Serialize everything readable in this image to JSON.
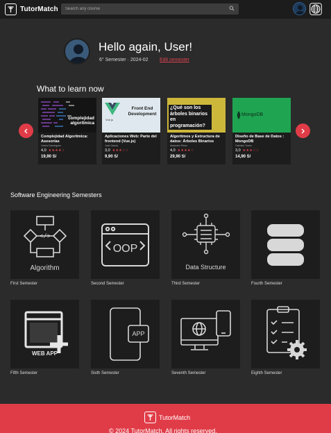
{
  "header": {
    "brand": "TutorMatch",
    "search_placeholder": "Search any course"
  },
  "hero": {
    "greeting": "Hello again, User!",
    "semester_info": "6° Semester · 2024-02",
    "edit_label": "Edit semester"
  },
  "learn_title": "What to learn now",
  "courses": [
    {
      "title": "Complejidad Algorítmica: Asesorías",
      "author": "Carlos Domínguez",
      "rating": "4,0",
      "price": "19,90 S/",
      "thumb_text": "complejidad algorítmica"
    },
    {
      "title": "Aplicaciones Web: Parte del frontend (Vue.js)",
      "author": "José García",
      "rating": "3,0",
      "price": "9,90 S/",
      "thumb_text": "Front End Development",
      "thumb_tag": "Vue.js"
    },
    {
      "title": "Algoritmos y Estructura de datos: Árboles Binarios",
      "author": "Alejandro Pérez",
      "rating": "4,0",
      "price": "29,90 S/",
      "thumb_text": "¿Qué son los árboles binarios en programación?"
    },
    {
      "title": "Diseño de Base de Datos : MongoDB",
      "author": "Gabriela Torres",
      "rating": "3,0",
      "price": "14,90 S/",
      "thumb_text": "MongoDB"
    }
  ],
  "semesters_title": "Software Engineering Semesters",
  "semesters": [
    {
      "label": "First Semester",
      "icon_text": "Algorithm"
    },
    {
      "label": "Second Semester",
      "icon_text": "OOP"
    },
    {
      "label": "Third Semester",
      "icon_text": "Data Structure"
    },
    {
      "label": "Fourth Semester"
    },
    {
      "label": "Fifth Semester",
      "icon_text": "WEB APP"
    },
    {
      "label": "Sixth Semester",
      "icon_text": "APP"
    },
    {
      "label": "Seventh Semester"
    },
    {
      "label": "Eighth Semester"
    }
  ],
  "footer": {
    "brand": "TutorMatch",
    "copyright": "© 2024 TutorMatch. All rights reserved."
  },
  "colors": {
    "accent": "#e03c48",
    "background": "#2b2b2b",
    "card": "#1d1d1d"
  }
}
